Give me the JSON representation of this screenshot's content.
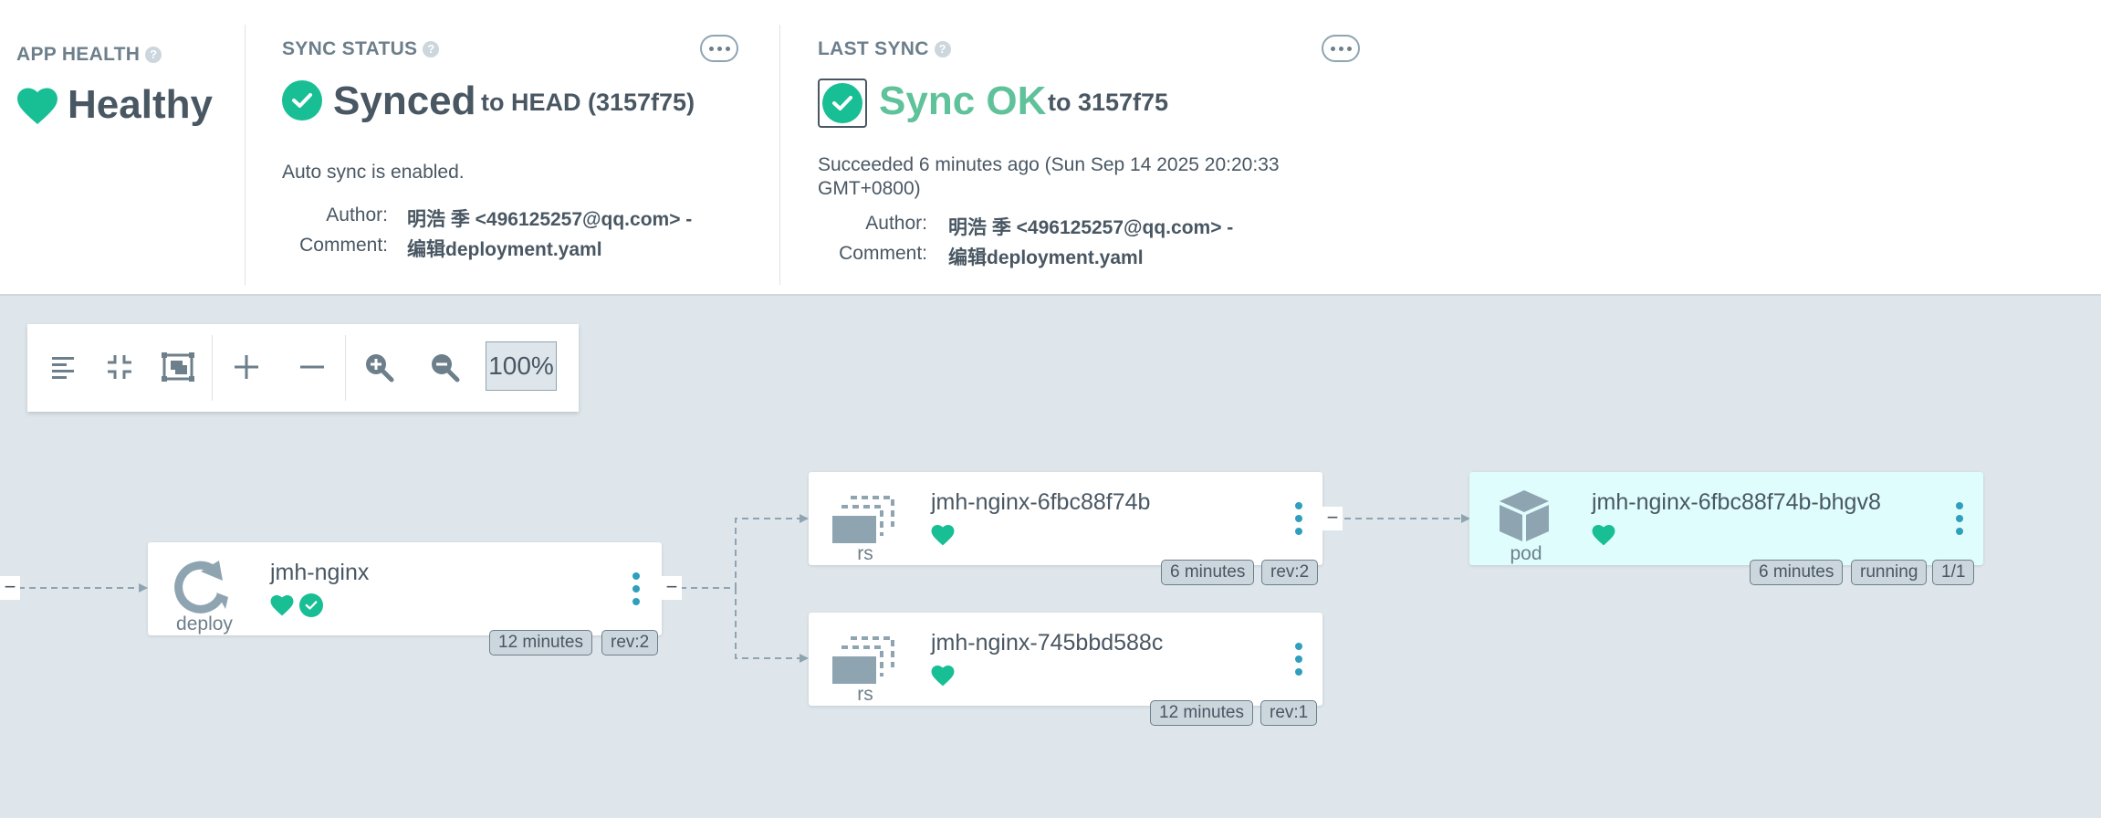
{
  "app_health": {
    "title": "APP HEALTH",
    "status": "Healthy",
    "help": "?"
  },
  "sync_status": {
    "title": "SYNC STATUS",
    "status": "Synced",
    "target": "to HEAD (3157f75)",
    "auto_sync": "Auto sync is enabled.",
    "author_label": "Author:",
    "author_value": "明浩 季 <496125257@qq.com> -",
    "comment_label": "Comment:",
    "comment_value": "编辑deployment.yaml",
    "help": "?"
  },
  "last_sync": {
    "title": "LAST SYNC",
    "status": "Sync OK",
    "target": "to 3157f75",
    "detail_line1": "Succeeded 6 minutes ago (Sun Sep 14 2025 20:20:33",
    "detail_line2": "GMT+0800)",
    "author_label": "Author:",
    "author_value": "明浩 季 <496125257@qq.com> -",
    "comment_label": "Comment:",
    "comment_value": "编辑deployment.yaml",
    "help": "?"
  },
  "toolbar": {
    "zoom": "100%",
    "buttons": [
      "list-view-icon",
      "collapse-icon",
      "fit-screen-icon",
      "expand-plus-icon",
      "collapse-minus-icon",
      "zoom-in-icon",
      "zoom-out-icon"
    ]
  },
  "graph": {
    "left_connector": "−",
    "deploy": {
      "name": "jmh-nginx",
      "kind": "deploy",
      "tags": [
        "12 minutes",
        "rev:2"
      ],
      "connector": "−"
    },
    "rs1": {
      "name": "jmh-nginx-6fbc88f74b",
      "kind": "rs",
      "tags": [
        "6 minutes",
        "rev:2"
      ],
      "connector": "−"
    },
    "rs2": {
      "name": "jmh-nginx-745bbd588c",
      "kind": "rs",
      "tags": [
        "12 minutes",
        "rev:1"
      ]
    },
    "pod": {
      "name": "jmh-nginx-6fbc88f74b-bhgv8",
      "kind": "pod",
      "tags": [
        "6 minutes",
        "running",
        "1/1"
      ]
    }
  },
  "colors": {
    "healthy": "#18be94",
    "text": "#495763",
    "muted": "#6d7f8b",
    "background": "#dee6eb",
    "kebab": "#2f9fbd",
    "pod_background": "#e0fdfd"
  }
}
